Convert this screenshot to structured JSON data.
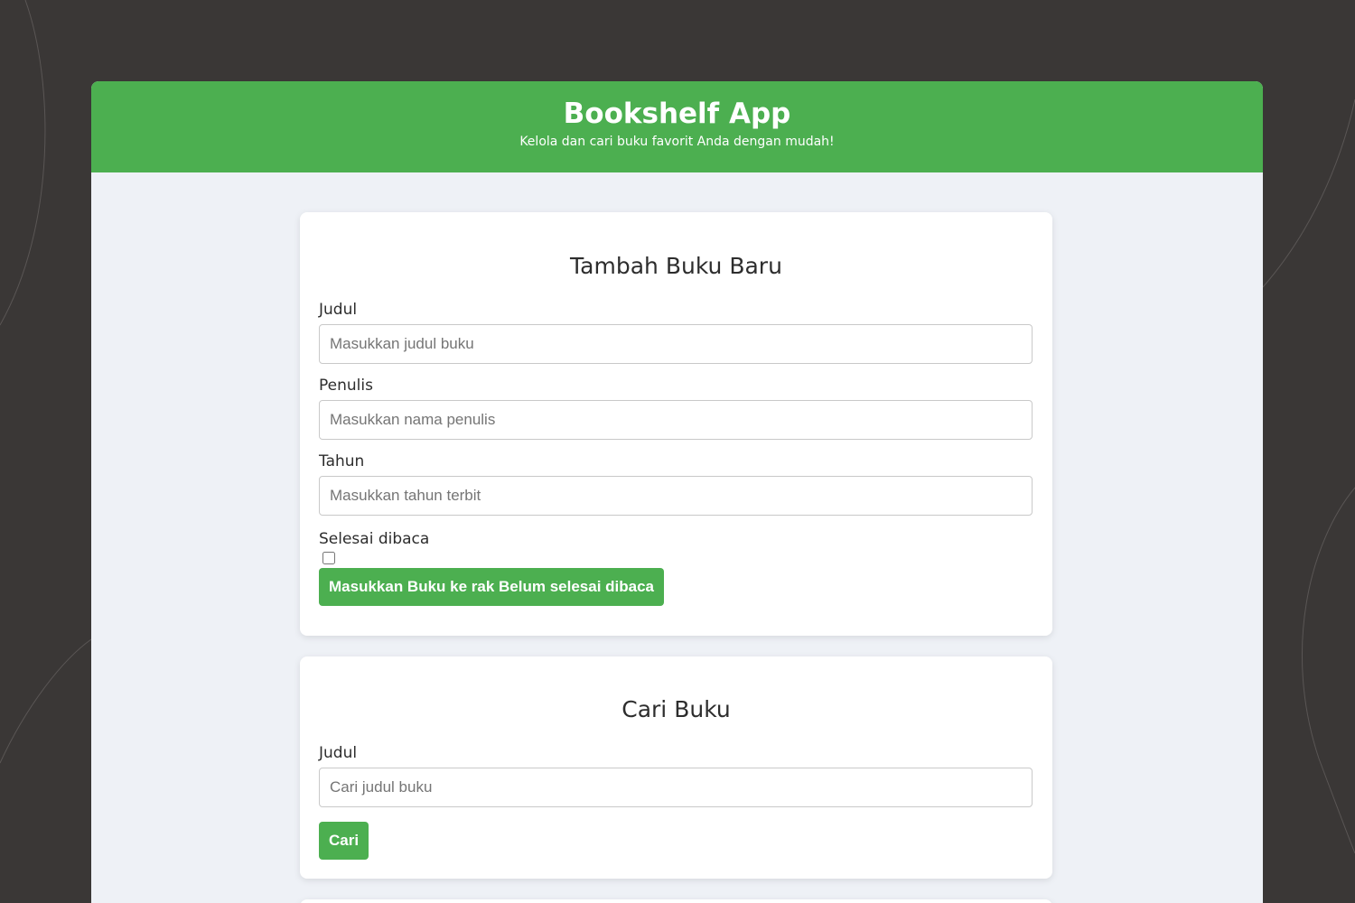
{
  "header": {
    "title": "Bookshelf App",
    "subtitle": "Kelola dan cari buku favorit Anda dengan mudah!"
  },
  "add_form": {
    "heading": "Tambah Buku Baru",
    "title_label": "Judul",
    "title_placeholder": "Masukkan judul buku",
    "author_label": "Penulis",
    "author_placeholder": "Masukkan nama penulis",
    "year_label": "Tahun",
    "year_placeholder": "Masukkan tahun terbit",
    "complete_label": "Selesai dibaca",
    "submit_label": "Masukkan Buku ke rak Belum selesai dibaca"
  },
  "search_form": {
    "heading": "Cari Buku",
    "title_label": "Judul",
    "title_placeholder": "Cari judul buku",
    "submit_label": "Cari"
  },
  "colors": {
    "primary": "#4caf50",
    "background": "#3a3736",
    "content_background": "#eef1f6"
  }
}
